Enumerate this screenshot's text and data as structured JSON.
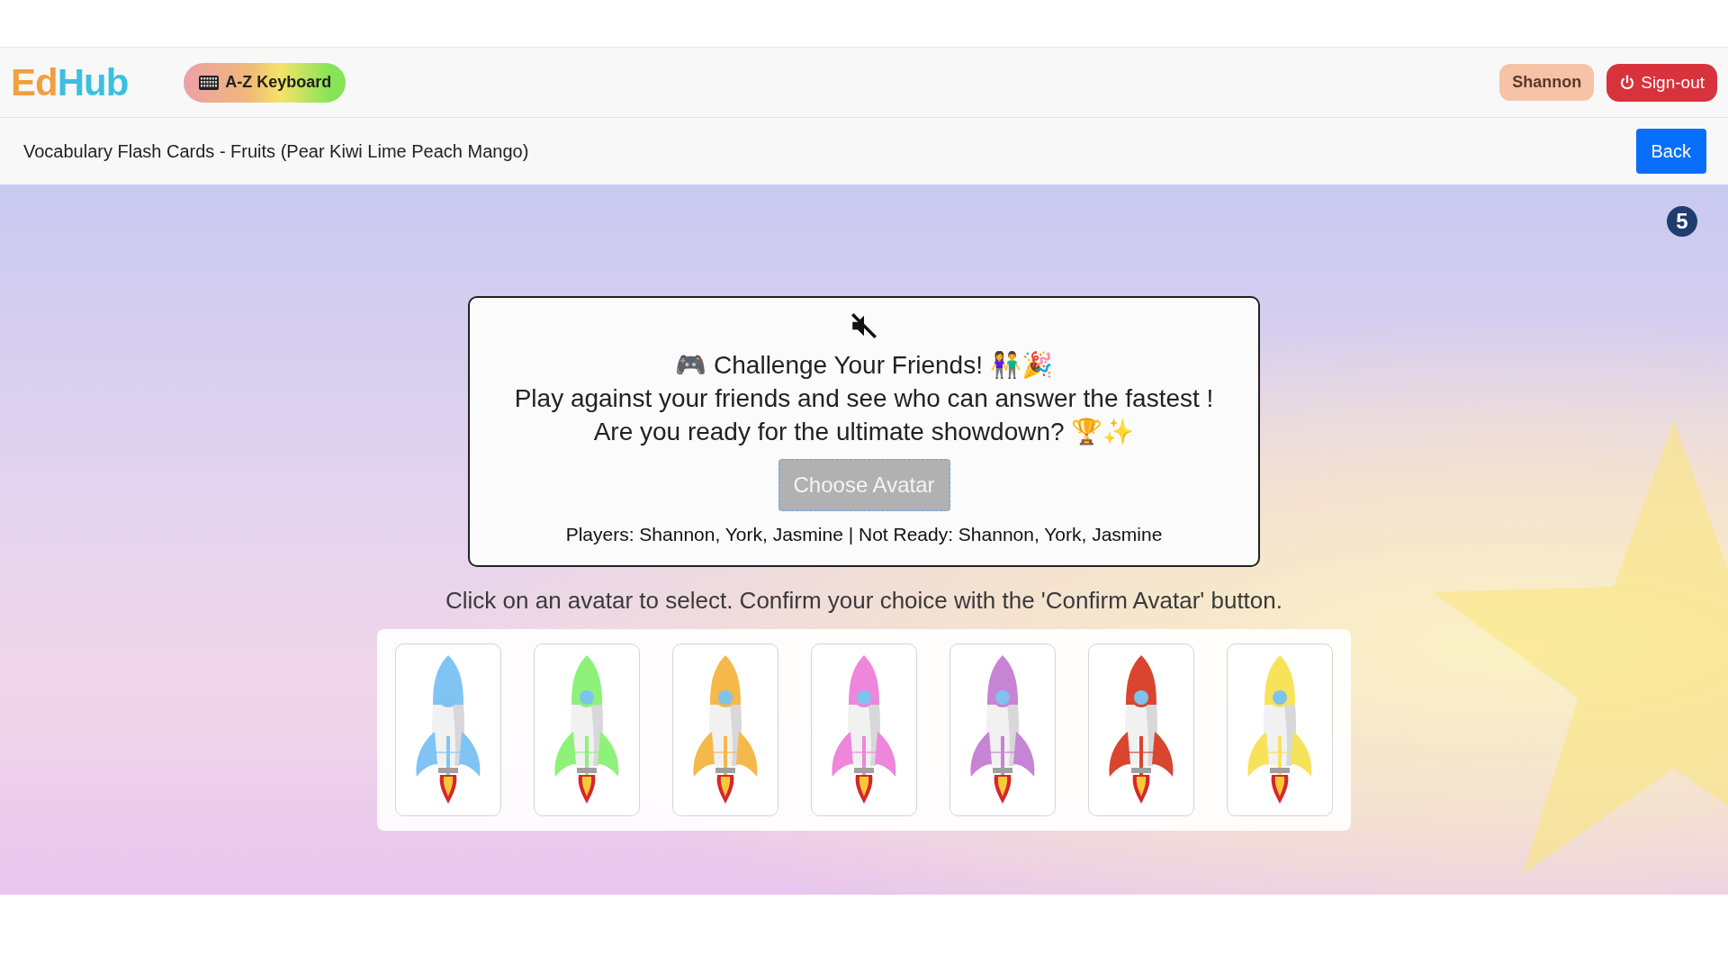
{
  "navbar": {
    "logo": "EdHub",
    "keyboard_button": "A-Z Keyboard",
    "user_badge": "Shannon",
    "signout_button": "Sign-out"
  },
  "subheader": {
    "title": "Vocabulary Flash Cards - Fruits (Pear Kiwi Lime Peach Mango)",
    "back_button": "Back"
  },
  "counter": "5",
  "modal": {
    "muted": true,
    "heading": "🎮 Challenge Your Friends! 👫🎉",
    "line_1": "Play against your friends and see who can answer the fastest !",
    "line_2": "Are you ready for the ultimate showdown? 🏆✨",
    "choose_button": {
      "label": "Choose Avatar",
      "disabled": true
    },
    "players": "Players: Shannon, York, Jasmine | Not Ready: Shannon, York, Jasmine"
  },
  "instruction": "Click on an avatar to select. Confirm your choice with the 'Confirm Avatar' button.",
  "avatars": [
    {
      "color": "#7fc4f5"
    },
    {
      "color": "#8ef27a"
    },
    {
      "color": "#f5b84a"
    },
    {
      "color": "#ee86dc"
    },
    {
      "color": "#c783d4"
    },
    {
      "color": "#d9452f"
    },
    {
      "color": "#f7e35a"
    }
  ]
}
